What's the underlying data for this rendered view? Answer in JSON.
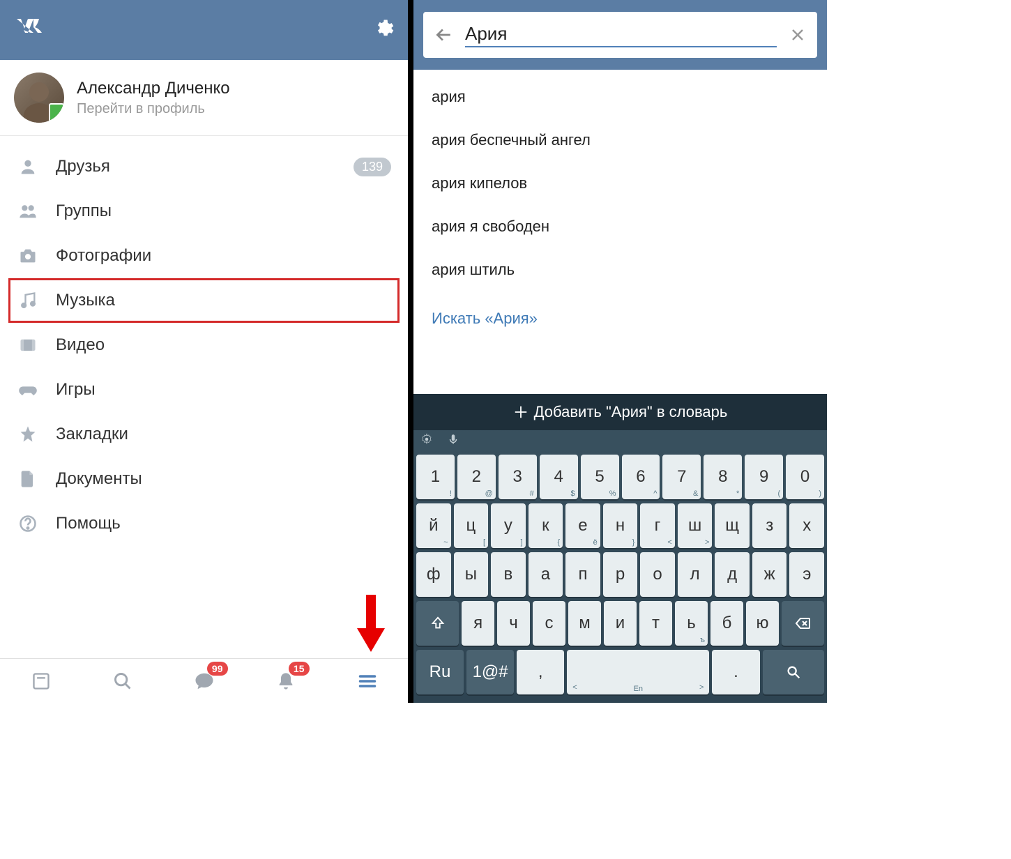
{
  "left": {
    "profile": {
      "name": "Александр Диченко",
      "subtitle": "Перейти в профиль"
    },
    "menu": [
      {
        "key": "friends",
        "label": "Друзья",
        "badge": "139",
        "highlighted": false
      },
      {
        "key": "groups",
        "label": "Группы",
        "badge": "",
        "highlighted": false
      },
      {
        "key": "photos",
        "label": "Фотографии",
        "badge": "",
        "highlighted": false
      },
      {
        "key": "music",
        "label": "Музыка",
        "badge": "",
        "highlighted": true
      },
      {
        "key": "video",
        "label": "Видео",
        "badge": "",
        "highlighted": false
      },
      {
        "key": "games",
        "label": "Игры",
        "badge": "",
        "highlighted": false
      },
      {
        "key": "bookmarks",
        "label": "Закладки",
        "badge": "",
        "highlighted": false
      },
      {
        "key": "documents",
        "label": "Документы",
        "badge": "",
        "highlighted": false
      },
      {
        "key": "help",
        "label": "Помощь",
        "badge": "",
        "highlighted": false
      }
    ],
    "tabbar": {
      "messages_badge": "99",
      "notifications_badge": "15"
    }
  },
  "right": {
    "search": {
      "value": "Ария"
    },
    "suggestions": [
      "ария",
      "ария беспечный ангел",
      "ария кипелов",
      "ария я свободен",
      "ария штиль"
    ],
    "search_link": "Искать «Ария»",
    "keyboard": {
      "add_word": "Добавить \"Ария\" в словарь",
      "row1": [
        {
          "m": "1",
          "s": "!"
        },
        {
          "m": "2",
          "s": "@"
        },
        {
          "m": "3",
          "s": "#"
        },
        {
          "m": "4",
          "s": "$"
        },
        {
          "m": "5",
          "s": "%"
        },
        {
          "m": "6",
          "s": "^"
        },
        {
          "m": "7",
          "s": "&"
        },
        {
          "m": "8",
          "s": "*"
        },
        {
          "m": "9",
          "s": "("
        },
        {
          "m": "0",
          "s": ")"
        }
      ],
      "row2": [
        {
          "m": "й",
          "s": "~"
        },
        {
          "m": "ц",
          "s": "["
        },
        {
          "m": "у",
          "s": "]"
        },
        {
          "m": "к",
          "s": "{"
        },
        {
          "m": "е",
          "s": "ё"
        },
        {
          "m": "н",
          "s": "}"
        },
        {
          "m": "г",
          "s": "<"
        },
        {
          "m": "ш",
          "s": ">"
        },
        {
          "m": "щ",
          "s": ""
        },
        {
          "m": "з",
          "s": ""
        },
        {
          "m": "х",
          "s": ""
        }
      ],
      "row3": [
        {
          "m": "ф",
          "s": ""
        },
        {
          "m": "ы",
          "s": ""
        },
        {
          "m": "в",
          "s": ""
        },
        {
          "m": "а",
          "s": ""
        },
        {
          "m": "п",
          "s": ""
        },
        {
          "m": "р",
          "s": ""
        },
        {
          "m": "о",
          "s": ""
        },
        {
          "m": "л",
          "s": ""
        },
        {
          "m": "д",
          "s": ""
        },
        {
          "m": "ж",
          "s": ""
        },
        {
          "m": "э",
          "s": ""
        }
      ],
      "row4": [
        {
          "m": "я",
          "s": ""
        },
        {
          "m": "ч",
          "s": ""
        },
        {
          "m": "с",
          "s": ""
        },
        {
          "m": "м",
          "s": ""
        },
        {
          "m": "и",
          "s": ""
        },
        {
          "m": "т",
          "s": ""
        },
        {
          "m": "ь",
          "s": "ъ"
        },
        {
          "m": "б",
          "s": ""
        },
        {
          "m": "ю",
          "s": ""
        }
      ],
      "bottom": {
        "lang": "Ru",
        "sym": "1@#",
        "comma": ",",
        "space_hint": "En",
        "dot": "."
      }
    }
  }
}
